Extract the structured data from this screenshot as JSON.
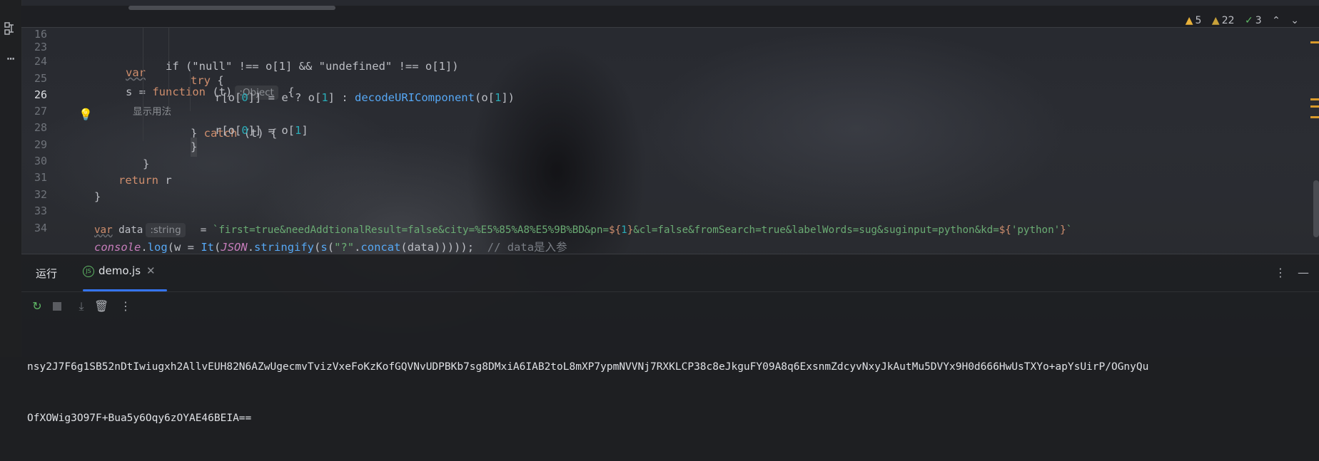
{
  "editor": {
    "sticky_line": {
      "number": "16",
      "kw_var": "var",
      "name": "s",
      "op": " = ",
      "kw_function": "function",
      "params": " (t)",
      "type_hint": ":Object",
      "brace": " {",
      "usage_hint": "显示用法"
    },
    "lines": [
      {
        "number": "23",
        "text": "            if (\"null\" !== o[1] && \"undefined\" !== o[1])"
      },
      {
        "number": "24",
        "text_kw": "try",
        "text_rest": " {"
      },
      {
        "number": "25",
        "text_a": "r[o[",
        "n1": "0",
        "text_b": "]] = e ? o[",
        "n2": "1",
        "text_c": "] : ",
        "fn": "decodeURIComponent",
        "text_d": "(o[",
        "n3": "1",
        "text_e": "])"
      },
      {
        "number": "26",
        "text_a": "} ",
        "kw": "catch",
        "text_b": " (t) {"
      },
      {
        "number": "27",
        "text_a": "r[o[",
        "n1": "0",
        "text_b": "]] = o[",
        "n2": "1",
        "text_c": "]"
      },
      {
        "number": "28",
        "text": "}"
      },
      {
        "number": "29",
        "text": "}"
      },
      {
        "number": "30",
        "kw": "return",
        "text": " r"
      },
      {
        "number": "31",
        "text": "}"
      },
      {
        "number": "32",
        "text": ""
      },
      {
        "number": "33",
        "kw": "var",
        "name": " data",
        "type_hint": ":string",
        "op": "  = ",
        "str_a": "`first=true&needAddtionalResult=false&city=%E5%85%A8%E5%9B%BD&pn=",
        "tmpl_a": "${",
        "n1": "1",
        "tmpl_b": "}",
        "str_b": "&cl=false&fromSearch=true&labelWords=sug&suginput=python&kd=",
        "tmpl_c": "${",
        "str_c": "'python'",
        "tmpl_d": "}",
        "str_d": "`"
      },
      {
        "number": "34",
        "it_console": "console",
        "t1": ".",
        "fn_log": "log",
        "t2": "(w = ",
        "fn_It": "It",
        "t3": "(",
        "it_json": "JSON",
        "t4": ".",
        "fn_stringify": "stringify",
        "t5": "(",
        "fn_s": "s",
        "t6": "(",
        "str_q": "\"?\"",
        "t7": ".",
        "fn_concat": "concat",
        "t8": "(data)))));  ",
        "comment": "// data是入参"
      }
    ]
  },
  "inspections": {
    "warnings_a": "5",
    "warnings_b": "22",
    "ok": "3"
  },
  "run_panel": {
    "tab_run": "运行",
    "tab_file": "demo.js",
    "output_line1": "nsy2J7F6g1SB52nDtIwiugxh2AllvEUH82N6AZwUgecmvTvizVxeFoKzKofGQVNvUDPBKb7sg8DMxiA6IAB2toL8mXP7ypmNVVNj7RXKLCP38c8eJkguFY09A8q6ExsnmZdcyvNxyJkAutMu5DVYx9H0d666HwUsTXYo+apYsUirP/OGnyQu",
    "output_line2": "OfXOWig3O97F+Bua5y6Oqy6zOYAE46BEIA=="
  },
  "colors": {
    "accent": "#3574f0",
    "keyword": "#cf8e6d",
    "function": "#56a8f5",
    "number": "#2aacb8",
    "string": "#6aab73"
  }
}
